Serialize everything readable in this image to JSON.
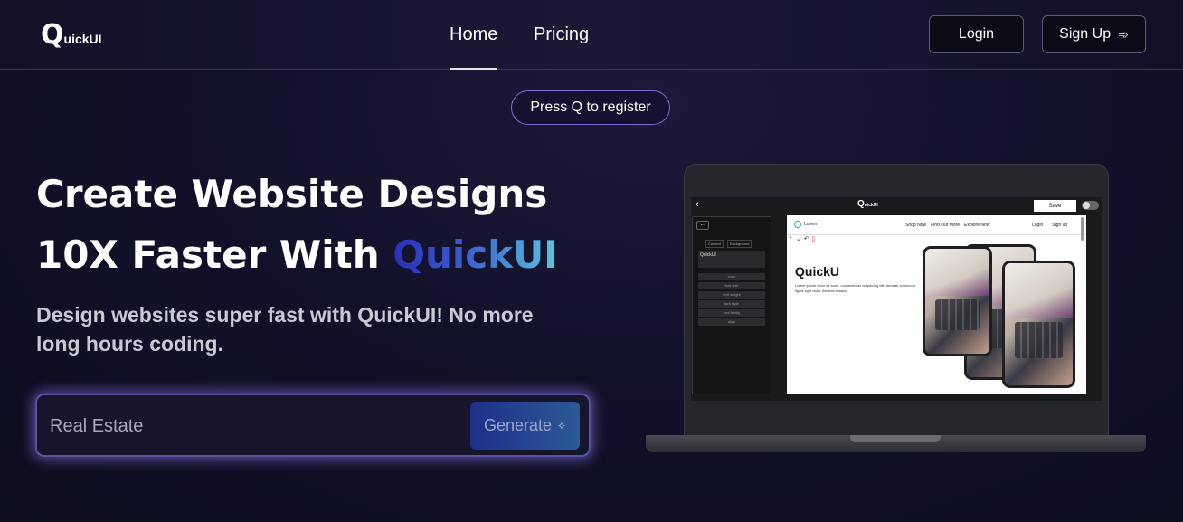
{
  "nav": {
    "logo_mark": "Q",
    "logo_text": "uickUI",
    "links": [
      {
        "label": "Home",
        "active": true
      },
      {
        "label": "Pricing",
        "active": false
      }
    ],
    "login_label": "Login",
    "signup_label": "Sign Up",
    "signup_icon": "arrow-right-icon"
  },
  "hero": {
    "pill_label": "Press Q to register",
    "headline_line1": "Create Website Designs",
    "headline_line2_prefix": "10X Faster With ",
    "headline_brand": "QuickUI",
    "subtitle": "Design websites super fast with QuickUI! No more long hours coding.",
    "generate": {
      "input_value": "Real Estate",
      "button_label": "Generate",
      "button_icon": "sparkle-icon"
    }
  },
  "preview": {
    "editor_logo": "Q",
    "editor_logo_small": "uickUI",
    "save_label": "Save",
    "tabs": [
      "Content",
      "Background"
    ],
    "field_value": "QuickUI",
    "options": [
      "color",
      "font size",
      "font weight",
      "font style",
      "font family",
      "align"
    ],
    "site_logo": "Lorem",
    "site_links": [
      "Shop Now",
      "Find Out More",
      "Explore Now"
    ],
    "site_auth": [
      "Login",
      "Sign up"
    ],
    "site_heading": "QuickU",
    "site_paragraph": "Lorem ipsum dolor sit amet, consectetuer adipiscing elit. Aenean commodo ligula eget dolor. Aenean massa."
  },
  "colors": {
    "background": "#12112a",
    "brand_gradient_start": "#2a2fb8",
    "brand_gradient_end": "#5ac6e0",
    "pill_border": "#7d6ad8",
    "generate_glow": "#9682ff"
  }
}
